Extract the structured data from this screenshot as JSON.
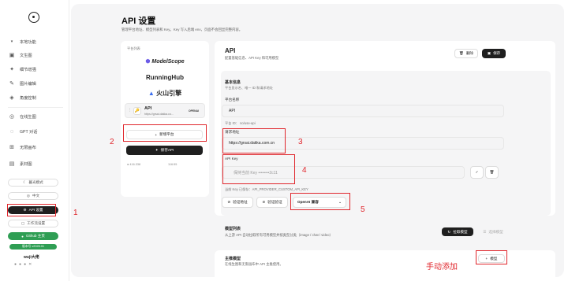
{
  "sidebar": {
    "section_label": "本地功能",
    "items": [
      {
        "label": "文生图",
        "icon": "image-icon"
      },
      {
        "label": "细节增强",
        "icon": "sparkle-icon"
      },
      {
        "label": "图片编辑",
        "icon": "edit-icon"
      },
      {
        "label": "角度控制",
        "icon": "cube-icon"
      },
      {
        "label": "在线生图",
        "icon": "globe-icon"
      },
      {
        "label": "GPT 对话",
        "icon": "chat-icon"
      },
      {
        "label": "无限画布",
        "icon": "canvas-icon"
      },
      {
        "label": "素材图",
        "icon": "folder-icon"
      }
    ],
    "theme_label": "暮光模式",
    "lang_label": "中文",
    "api_label": "API 设置",
    "workflow_label": "工作流设置",
    "github_label": "Github 主页",
    "version_label": "版本号 v2026.01",
    "user_label": "wuji大佬"
  },
  "page": {
    "title": "API 设置",
    "subtitle": "管理平台地址、模型列表和 Key。Key 写入后端 env，页面不会回显完整内容。"
  },
  "providers": {
    "title": "平台列表",
    "brands": [
      "ModelScope",
      "RunningHub",
      "火山引擎"
    ],
    "selected": {
      "name": "API",
      "url": "https://grsai.dakka.co...",
      "tag": "OPENAI"
    },
    "add_label": "新增平台",
    "save_label": "保存API",
    "footer_left": "● 416.338",
    "footer_right": "116:55"
  },
  "detail": {
    "title": "API",
    "subtitle": "配置基础信息、API Key 和可用模型",
    "delete_label": "删除",
    "save_label": "保存",
    "basic_title": "基本信息",
    "basic_sub": "平台显示名、唯一 ID 和请求地址",
    "name_label": "平台名称",
    "name_value": "API",
    "id_text": "平台 ID：  no/use-api",
    "url_label": "请求地址",
    "url_value": "https://grsai.dakka.com.cn",
    "key_label": "API Key",
    "key_placeholder": "保持当前 Key  ••••••••2c11",
    "env_text": "当前 Key 已保存：API_PROVIDER_CUSTOM_API_KEY",
    "verify_url_label": "验证地址",
    "verify_key_label": "验证验证",
    "api_type_value": "OpenAI 兼容"
  },
  "models": {
    "title": "模型列表",
    "subtitle": "从上游 API 自动拉取所有可用模型并按类型分类（image / chat / video）",
    "fetch_label": "拉取模型",
    "select_label": "选择模型"
  },
  "main_model": {
    "title": "主推模型",
    "subtitle": "在线生图和无限画布中 API 主推使用。",
    "add_label": "模型"
  },
  "annotations": {
    "n1": "1",
    "n2": "2",
    "n3": "3",
    "n4": "4",
    "n5": "5",
    "manual_add": "手动添加"
  },
  "colors": {
    "accent_dark": "#1f1f1f",
    "annotation_red": "#e0262c",
    "github_green": "#2f9e54"
  }
}
